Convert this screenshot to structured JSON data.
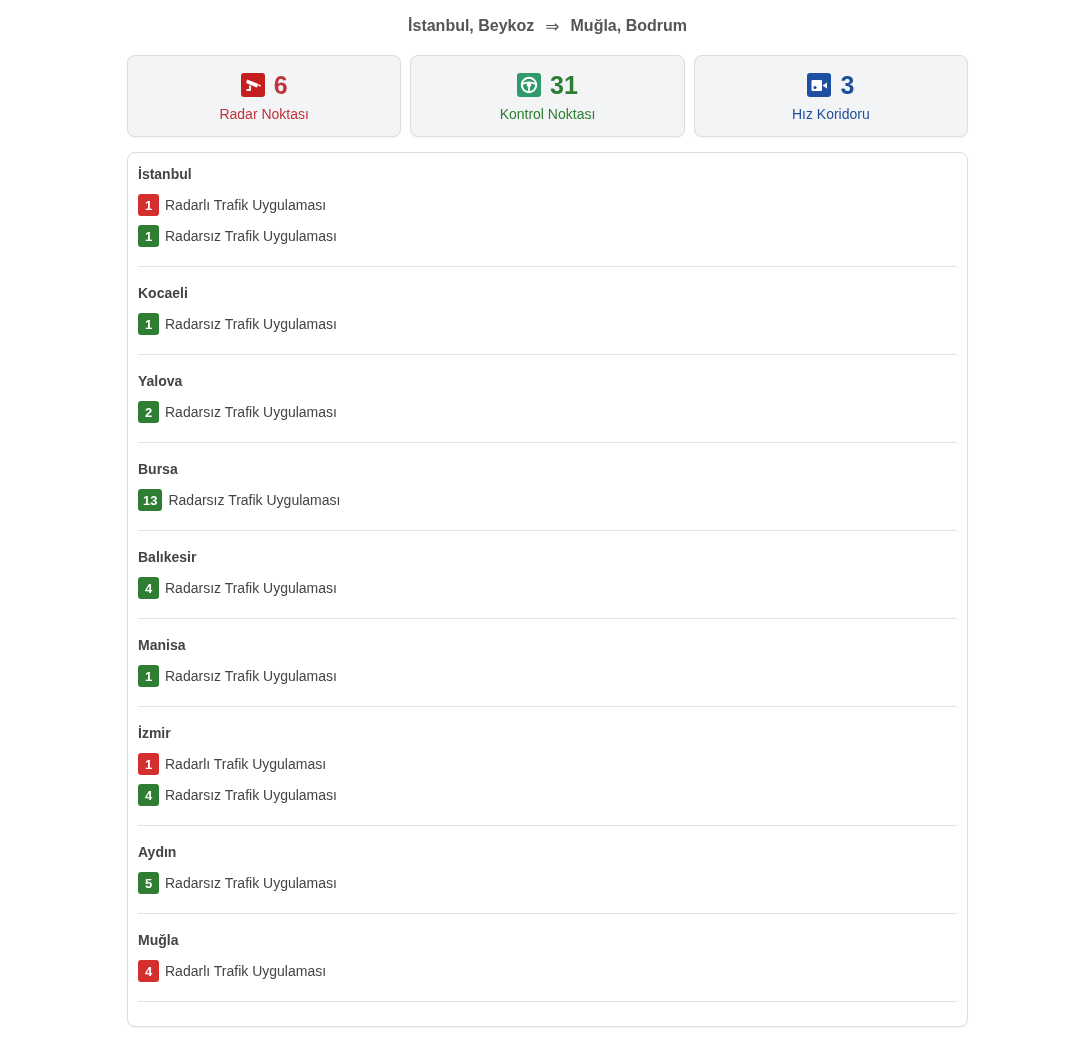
{
  "route": {
    "origin": "İstanbul, Beykoz",
    "arrow": "⇒",
    "destination": "Muğla, Bodrum"
  },
  "summary": [
    {
      "kind": "radar",
      "count": "6",
      "label": "Radar Noktası"
    },
    {
      "kind": "control",
      "count": "31",
      "label": "Kontrol Noktası"
    },
    {
      "kind": "corridor",
      "count": "3",
      "label": "Hız Koridoru"
    }
  ],
  "cities": [
    {
      "name": "İstanbul",
      "items": [
        {
          "kind": "radar",
          "count": "1",
          "label": "Radarlı Trafik Uygulaması"
        },
        {
          "kind": "control",
          "count": "1",
          "label": "Radarsız Trafik Uygulaması"
        }
      ]
    },
    {
      "name": "Kocaeli",
      "items": [
        {
          "kind": "control",
          "count": "1",
          "label": "Radarsız Trafik Uygulaması"
        }
      ]
    },
    {
      "name": "Yalova",
      "items": [
        {
          "kind": "control",
          "count": "2",
          "label": "Radarsız Trafik Uygulaması"
        }
      ]
    },
    {
      "name": "Bursa",
      "items": [
        {
          "kind": "control",
          "count": "13",
          "label": "Radarsız Trafik Uygulaması"
        }
      ]
    },
    {
      "name": "Balıkesir",
      "items": [
        {
          "kind": "control",
          "count": "4",
          "label": "Radarsız Trafik Uygulaması"
        }
      ]
    },
    {
      "name": "Manisa",
      "items": [
        {
          "kind": "control",
          "count": "1",
          "label": "Radarsız Trafik Uygulaması"
        }
      ]
    },
    {
      "name": "İzmir",
      "items": [
        {
          "kind": "radar",
          "count": "1",
          "label": "Radarlı Trafik Uygulaması"
        },
        {
          "kind": "control",
          "count": "4",
          "label": "Radarsız Trafik Uygulaması"
        }
      ]
    },
    {
      "name": "Aydın",
      "items": [
        {
          "kind": "control",
          "count": "5",
          "label": "Radarsız Trafik Uygulaması"
        }
      ]
    },
    {
      "name": "Muğla",
      "items": [
        {
          "kind": "radar",
          "count": "4",
          "label": "Radarlı Trafik Uygulaması"
        }
      ]
    }
  ]
}
